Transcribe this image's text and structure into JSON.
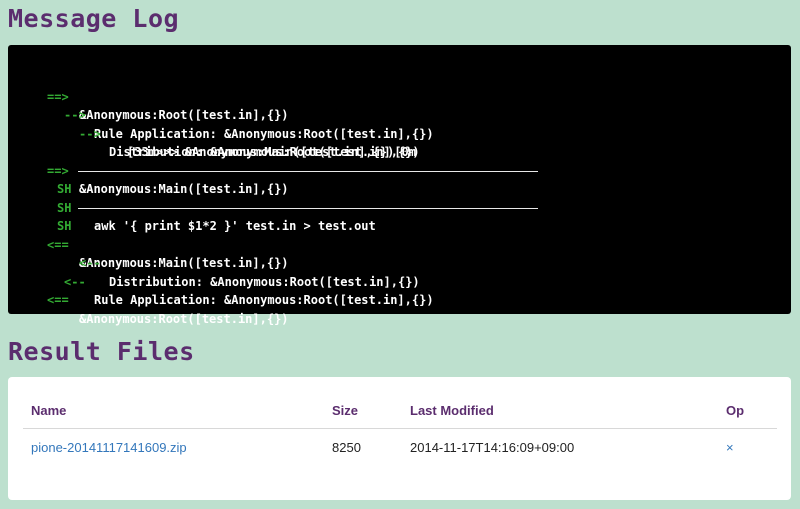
{
  "log_section": {
    "title": "Message Log",
    "lines": [
      {
        "marker": "==>",
        "text": "&Anonymous:Root([test.in],{})"
      },
      {
        "marker": "-->",
        "text": "Rule Application: &Anonymous:Root([test.in],{})"
      },
      {
        "marker": "-->",
        "text": "Distribution: &Anonymous:Root([test.in],{})"
      },
      {
        "marker": "",
        "text": "[33m>>> &Anonymous:Main([test.in],{})[0m"
      },
      {
        "marker": "==>",
        "text": "&Anonymous:Main([test.in],{})"
      },
      {
        "marker": "SH",
        "text": ""
      },
      {
        "marker": "SH",
        "text": "awk '{ print $1*2 }' test.in > test.out"
      },
      {
        "marker": "SH",
        "text": ""
      },
      {
        "marker": "<==",
        "text": "&Anonymous:Main([test.in],{})"
      },
      {
        "marker": "<--",
        "text": "Distribution: &Anonymous:Root([test.in],{})"
      },
      {
        "marker": "<--",
        "text": "Rule Application: &Anonymous:Root([test.in],{})"
      },
      {
        "marker": "<==",
        "text": "&Anonymous:Root([test.in],{})"
      }
    ]
  },
  "files_section": {
    "title": "Result Files",
    "columns": {
      "name": "Name",
      "size": "Size",
      "modified": "Last Modified",
      "op": "Op"
    },
    "rows": [
      {
        "name": "pione-20141117141609.zip",
        "size": "8250",
        "modified": "2014-11-17T14:16:09+09:00",
        "op": "×"
      }
    ]
  },
  "colors": {
    "background": "#bde0ce",
    "title": "#5b2d6e",
    "log_background": "#000000",
    "marker": "#33aa33",
    "link": "#3377bb"
  }
}
